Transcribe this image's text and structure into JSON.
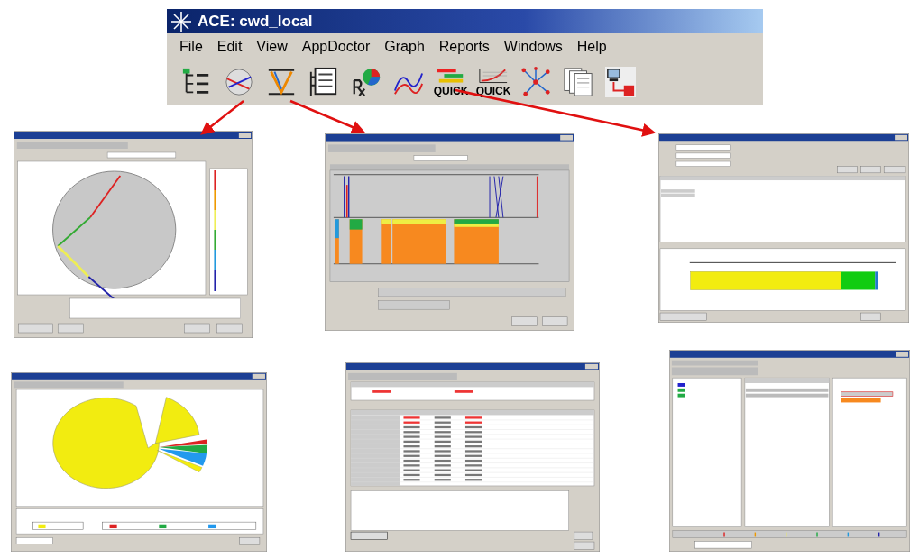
{
  "window": {
    "title": "ACE: cwd_local"
  },
  "menu": [
    "File",
    "Edit",
    "View",
    "AppDoctor",
    "Graph",
    "Reports",
    "Windows",
    "Help"
  ],
  "toolbar": [
    {
      "kind": "tree"
    },
    {
      "kind": "circle"
    },
    {
      "kind": "exchange"
    },
    {
      "kind": "sheet"
    },
    {
      "kind": "rx"
    },
    {
      "kind": "curve"
    },
    {
      "kind": "quick-bars",
      "label": "QUICK"
    },
    {
      "kind": "quick-curve",
      "label": "QUICK"
    },
    {
      "kind": "network"
    },
    {
      "kind": "pages"
    },
    {
      "kind": "computer"
    }
  ],
  "thumbnails": [
    {
      "kind": "circle"
    },
    {
      "kind": "exchange"
    },
    {
      "kind": "quickbw"
    },
    {
      "kind": "pie"
    },
    {
      "kind": "table"
    },
    {
      "kind": "characteristics"
    }
  ]
}
